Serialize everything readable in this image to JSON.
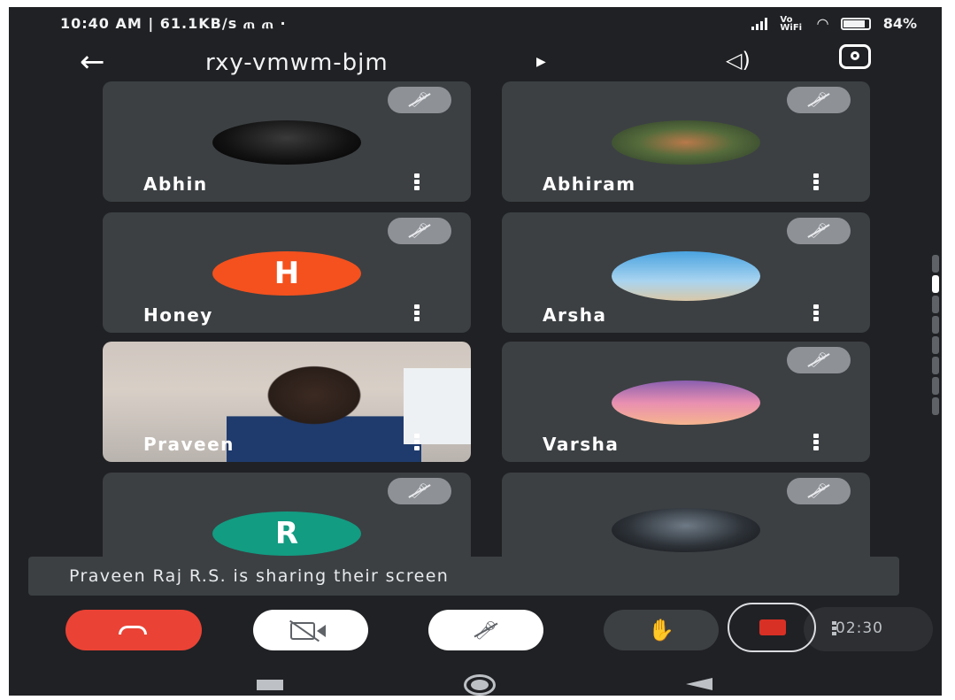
{
  "status_bar": {
    "time_network": "10:40 AM | 61.1KB/s ጠ ጠ  ·",
    "wifi_label": "Vo WiFi",
    "battery": "84%"
  },
  "header": {
    "meeting_code": "rxy-vmwm-bjm",
    "back_icon": "back-arrow-icon",
    "speaker_icon": "speaker-icon",
    "switch_camera_icon": "switch-camera-icon"
  },
  "participants": [
    {
      "name": "Abhin",
      "type": "photo",
      "muted": true
    },
    {
      "name": "Abhiram",
      "type": "photo",
      "muted": true
    },
    {
      "name": "Honey",
      "type": "letter",
      "letter": "H",
      "color": "#f4511e",
      "muted": true
    },
    {
      "name": "Arsha",
      "type": "photo",
      "muted": true
    },
    {
      "name": "Praveen",
      "type": "video",
      "muted": false
    },
    {
      "name": "Varsha",
      "type": "photo",
      "muted": true
    },
    {
      "name": "",
      "type": "letter",
      "letter": "R",
      "color": "#129c82",
      "muted": true
    },
    {
      "name": "",
      "type": "photo",
      "muted": true
    }
  ],
  "toast": {
    "message": "Praveen Raj R.S. is sharing their screen"
  },
  "controls": {
    "hangup_icon": "hangup-icon",
    "camera_icon": "camera-off-icon",
    "mic_icon": "mic-off-icon",
    "hand_icon": "raise-hand-icon",
    "hand_glyph": "✋",
    "record_icon": "record-icon",
    "timer": "02:30"
  },
  "colors": {
    "background": "#202124",
    "tile": "#3c4043",
    "hangup": "#ea4335"
  }
}
